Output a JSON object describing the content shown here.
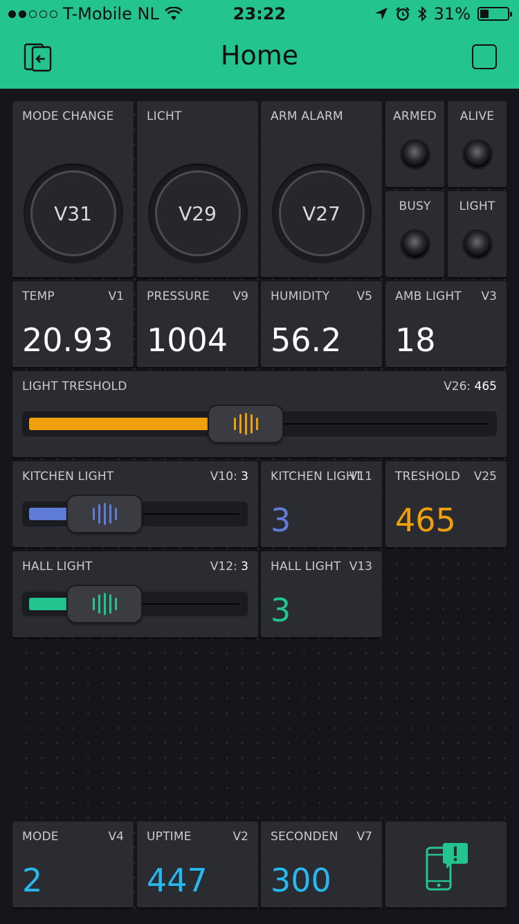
{
  "status_bar": {
    "carrier": "T-Mobile NL",
    "time": "23:22",
    "battery": "31%",
    "battery_level": 0.31
  },
  "header": {
    "title": "Home"
  },
  "colors": {
    "accent": "#23c48e",
    "orange": "#f0a00c",
    "blue": "#5f7cd9",
    "cyan": "#27b8f0"
  },
  "buttons": [
    {
      "label": "MODE CHANGE",
      "pin": "V31"
    },
    {
      "label": "LICHT",
      "pin": "V29"
    },
    {
      "label": "ARM ALARM",
      "pin": "V27"
    }
  ],
  "leds": [
    {
      "label": "ARMED"
    },
    {
      "label": "ALIVE"
    },
    {
      "label": "BUSY"
    },
    {
      "label": "LIGHT"
    }
  ],
  "displays_row1": [
    {
      "label": "TEMP",
      "pin": "V1",
      "value": "20.93"
    },
    {
      "label": "PRESSURE",
      "pin": "V9",
      "value": "1004"
    },
    {
      "label": "HUMIDITY",
      "pin": "V5",
      "value": "56.2"
    },
    {
      "label": "AMB LIGHT",
      "pin": "V3",
      "value": "18"
    }
  ],
  "light_treshold": {
    "label": "LIGHT TRESHOLD",
    "pin": "V26:",
    "value": "465",
    "fraction": 0.465
  },
  "kitchen_light_slider": {
    "label": "KITCHEN LIGHT",
    "pin": "V10:",
    "value": "3",
    "fraction": 0.3
  },
  "kitchen_light_display": {
    "label": "KITCHEN LIGHT",
    "pin": "V11",
    "value": "3"
  },
  "treshold_display": {
    "label": "TRESHOLD",
    "pin": "V25",
    "value": "465"
  },
  "hall_light_slider": {
    "label": "HALL LIGHT",
    "pin": "V12:",
    "value": "3",
    "fraction": 0.3
  },
  "hall_light_display": {
    "label": "HALL LIGHT",
    "pin": "V13",
    "value": "3"
  },
  "bottom_displays": [
    {
      "label": "MODE",
      "pin": "V4",
      "value": "2"
    },
    {
      "label": "UPTIME",
      "pin": "V2",
      "value": "447"
    },
    {
      "label": "SECONDEN",
      "pin": "V7",
      "value": "300"
    }
  ],
  "icons": {
    "back": "exit-to-left-icon",
    "square": "square-icon",
    "notification": "phone-alert-icon"
  }
}
